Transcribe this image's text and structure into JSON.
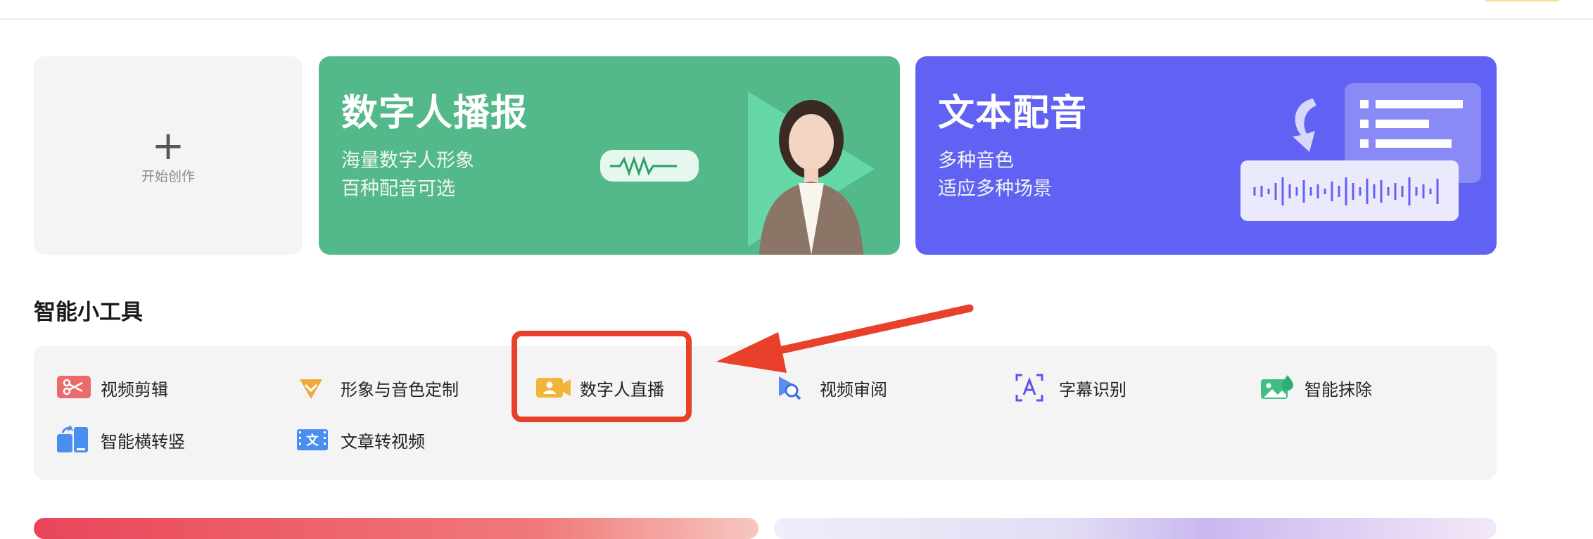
{
  "header": {},
  "banners": {
    "create": {
      "plus": "+",
      "label": "开始创作"
    },
    "digital_human": {
      "title": "数字人播报",
      "sub1": "海量数字人形象",
      "sub2": "百种配音可选"
    },
    "text_voice": {
      "title": "文本配音",
      "sub1": "多种音色",
      "sub2": "适应多种场景"
    }
  },
  "tools_section": {
    "title": "智能小工具",
    "items": [
      {
        "label": "视频剪辑",
        "icon": "scissors-icon"
      },
      {
        "label": "形象与音色定制",
        "icon": "diamond-icon"
      },
      {
        "label": "数字人直播",
        "icon": "live-camera-icon"
      },
      {
        "label": "视频审阅",
        "icon": "review-magnifier-icon"
      },
      {
        "label": "字幕识别",
        "icon": "subtitle-scan-icon"
      },
      {
        "label": "智能抹除",
        "icon": "image-erase-icon"
      },
      {
        "label": "智能横转竖",
        "icon": "rotate-screen-icon"
      },
      {
        "label": "文章转视频",
        "icon": "article-video-icon"
      }
    ],
    "wen_glyph": "文"
  },
  "colors": {
    "digital_card": "#54b98a",
    "voice_card": "#6161f3",
    "highlight": "#e8402a"
  }
}
